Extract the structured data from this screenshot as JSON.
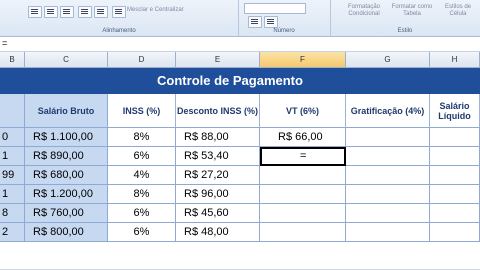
{
  "ribbon": {
    "merge_label": "Mesclar e Centralizar",
    "group_alignment": "Alinhamento",
    "group_number": "Número",
    "group_style": "Estilo",
    "style_conditional": "Formatação Condicional",
    "style_table": "Formatar como Tabela",
    "style_cell": "Estilos de Célula"
  },
  "formula_bar": {
    "content": "="
  },
  "columns": [
    "B",
    "C",
    "D",
    "E",
    "F",
    "G",
    "H"
  ],
  "selected_column": "F",
  "title": "Controle de Pagamento",
  "headers": {
    "salario": "Salário Bruto",
    "inss": "INSS (%)",
    "desconto": "Desconto INSS (%)",
    "vt": "VT (6%)",
    "gratificacao": "Gratificação (4%)",
    "liquido": "Salário Líquido"
  },
  "rows": [
    {
      "b": "0",
      "salario": "R$ 1.100,00",
      "inss": "8%",
      "desconto": "R$ 88,00",
      "vt": "R$ 66,00"
    },
    {
      "b": "1",
      "salario": "R$ 890,00",
      "inss": "6%",
      "desconto": "R$ 53,40",
      "vt": "="
    },
    {
      "b": "99",
      "salario": "R$ 680,00",
      "inss": "4%",
      "desconto": "R$ 27,20",
      "vt": ""
    },
    {
      "b": "1",
      "salario": "R$ 1.200,00",
      "inss": "8%",
      "desconto": "R$ 96,00",
      "vt": ""
    },
    {
      "b": "8",
      "salario": "R$ 760,00",
      "inss": "6%",
      "desconto": "R$ 45,60",
      "vt": ""
    },
    {
      "b": "2",
      "salario": "R$ 800,00",
      "inss": "6%",
      "desconto": "R$ 48,00",
      "vt": ""
    }
  ]
}
